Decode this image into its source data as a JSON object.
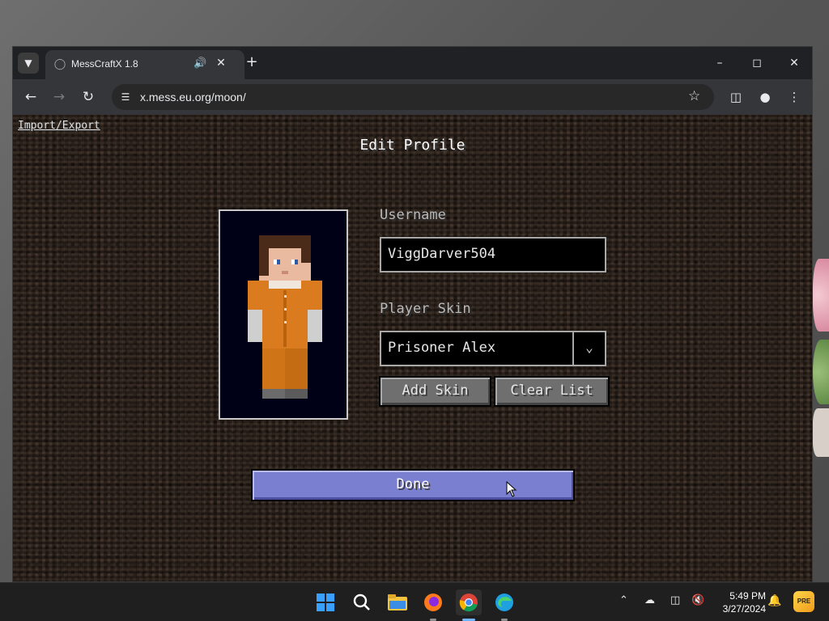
{
  "browser": {
    "tab_title": "MessCraftX 1.8",
    "url": "x.mess.eu.org/moon/"
  },
  "game": {
    "import_export": "Import/Export",
    "screen_title": "Edit Profile",
    "username_label": "Username",
    "username_value": "ViggDarver504",
    "skin_label": "Player Skin",
    "skin_value": "Prisoner Alex",
    "add_skin_label": "Add Skin",
    "clear_list_label": "Clear List",
    "done_label": "Done"
  },
  "taskbar": {
    "time": "5:49 PM",
    "date": "3/27/2024"
  },
  "colors": {
    "done_button": "#7b7fcf",
    "skin_background": "#000016",
    "prisoner_orange": "#d97b1e"
  },
  "icons": [
    "tab-list-icon",
    "globe-icon",
    "speaker-icon",
    "close-icon",
    "plus-icon",
    "minimize-icon",
    "maximize-icon",
    "back-icon",
    "forward-icon",
    "reload-icon",
    "site-info-icon",
    "star-icon",
    "side-panel-icon",
    "profile-icon",
    "menu-icon",
    "chevron-down-icon",
    "cursor-icon",
    "windows-start-icon",
    "search-icon",
    "file-explorer-icon",
    "firefox-icon",
    "chrome-icon",
    "edge-icon",
    "chevron-up-icon",
    "cloud-off-icon",
    "monitor-icon",
    "volume-icon",
    "bell-icon",
    "copilot-icon"
  ]
}
